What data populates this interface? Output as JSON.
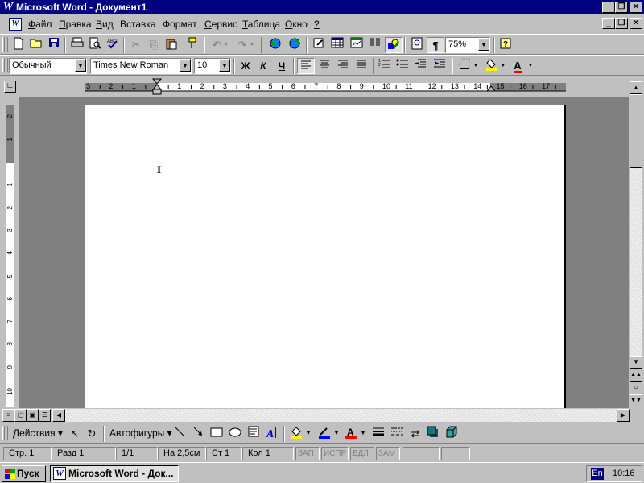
{
  "window": {
    "title": "Microsoft Word - Документ1",
    "title_icon": "W",
    "minimize": "_",
    "maximize": "❐",
    "close": "×",
    "doc_minimize": "_",
    "doc_maximize": "❐",
    "doc_close": "×"
  },
  "menu": {
    "doc_icon": "W",
    "items": [
      {
        "label": "Файл",
        "u": "Ф",
        "rest": "айл"
      },
      {
        "label": "Правка",
        "u": "П",
        "rest": "равка"
      },
      {
        "label": "Вид",
        "u": "В",
        "rest": "ид"
      },
      {
        "label": "Вставка",
        "u": "",
        "rest": "Вставка"
      },
      {
        "label": "Формат",
        "u": "",
        "rest": "Формат"
      },
      {
        "label": "Сервис",
        "u": "С",
        "rest": "ервис"
      },
      {
        "label": "Таблица",
        "u": "Т",
        "rest": "аблица"
      },
      {
        "label": "Окно",
        "u": "О",
        "rest": "кно"
      },
      {
        "label": "?",
        "u": "?",
        "rest": ""
      }
    ]
  },
  "standard_toolbar": {
    "zoom": "75%",
    "buttons": [
      "new-doc",
      "open",
      "save",
      "print",
      "print-preview",
      "spelling",
      "cut",
      "copy",
      "paste",
      "format-painter",
      "undo",
      "redo",
      "web-toolbar",
      "hyperlink",
      "tables-borders",
      "insert-table",
      "insert-excel",
      "columns",
      "drawing",
      "document-map",
      "show-formatting",
      "help"
    ]
  },
  "format_toolbar": {
    "style": "Обычный",
    "font": "Times New Roman",
    "size": "10",
    "bold": "Ж",
    "italic": "К",
    "underline": "Ч",
    "font_color": "A"
  },
  "ruler": {
    "h_labels": [
      "3",
      "2",
      "1",
      "1",
      "2",
      "3",
      "4",
      "5",
      "6",
      "7",
      "8",
      "9",
      "10",
      "11",
      "12",
      "13",
      "14",
      "15",
      "16",
      "17"
    ],
    "v_labels": [
      "2",
      "1",
      "1",
      "2",
      "3",
      "4",
      "5",
      "6",
      "7",
      "8",
      "9",
      "10"
    ]
  },
  "document": {
    "cursor_mark": "I",
    "content": ""
  },
  "drawing_toolbar": {
    "actions": "Действия",
    "autoshapes": "Автофигуры",
    "line_color": "#0000ff",
    "font_color": "#ff0000",
    "fill_color": "#ffff00"
  },
  "status": {
    "page": "Стр. 1",
    "section": "Разд 1",
    "pages": "1/1",
    "at": "На 2,5см",
    "line": "Ст 1",
    "col": "Кол 1",
    "rec": "ЗАП",
    "trk": "ИСПР",
    "ext": "ВДЛ",
    "ovr": "ЗАМ"
  },
  "taskbar": {
    "start": "Пуск",
    "task": "Microsoft Word - Док...",
    "lang": "En",
    "time": "10:16"
  },
  "colors": {
    "titlebar": "#000080",
    "face": "#c0c0c0",
    "workspace": "#808080"
  }
}
